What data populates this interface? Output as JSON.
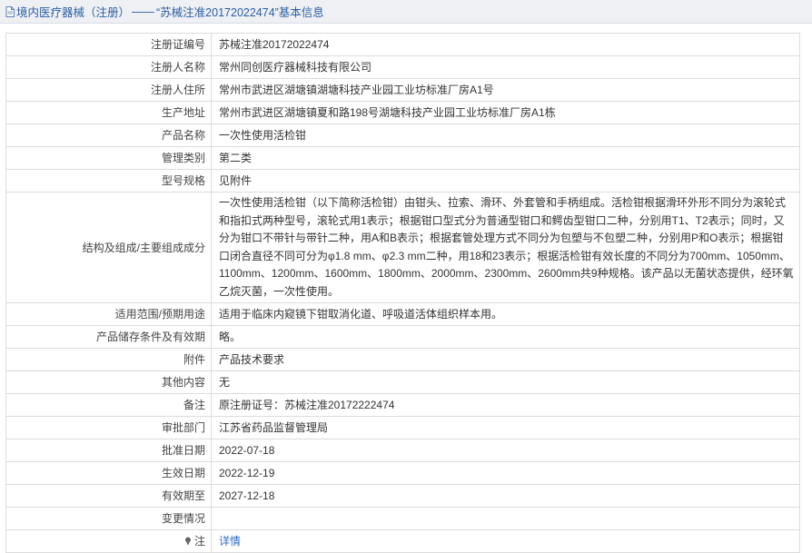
{
  "header": {
    "prefix": "境内医疗器械（注册）",
    "separator": "——",
    "title": "“苏械注准20172022474”基本信息",
    "icon": "document-icon"
  },
  "rows": [
    {
      "label": "注册证编号",
      "value": "苏械注准20172022474"
    },
    {
      "label": "注册人名称",
      "value": "常州同创医疗器械科技有限公司"
    },
    {
      "label": "注册人住所",
      "value": "常州市武进区湖塘镇湖塘科技产业园工业坊标准厂房A1号"
    },
    {
      "label": "生产地址",
      "value": "常州市武进区湖塘镇夏和路198号湖塘科技产业园工业坊标准厂房A1栋"
    },
    {
      "label": "产品名称",
      "value": "一次性使用活检钳"
    },
    {
      "label": "管理类别",
      "value": "第二类"
    },
    {
      "label": "型号规格",
      "value": "见附件"
    },
    {
      "label": "结构及组成/主要组成成分",
      "value": "一次性使用活检钳（以下简称活检钳）由钳头、拉索、滑环、外套管和手柄组成。活检钳根据滑环外形不同分为滚轮式和指扣式两种型号，滚轮式用1表示；根据钳口型式分为普通型钳口和鳄齿型钳口二种，分别用T1、T2表示；同时，又分为钳口不带针与带针二种，用A和B表示；根据套管处理方式不同分为包塑与不包塑二种，分别用P和O表示；根据钳口闭合直径不同可分为φ1.8 mm、φ2.3 mm二种，用18和23表示；根据活检钳有效长度的不同分为700mm、1050mm、1100mm、1200mm、1600mm、1800mm、2000mm、2300mm、2600mm共9种规格。该产品以无菌状态提供，经环氧乙烷灭菌，一次性使用。"
    },
    {
      "label": "适用范围/预期用途",
      "value": "适用于临床内窥镜下钳取消化道、呼吸道活体组织样本用。"
    },
    {
      "label": "产品储存条件及有效期",
      "value": "略。"
    },
    {
      "label": "附件",
      "value": "产品技术要求"
    },
    {
      "label": "其他内容",
      "value": "无"
    },
    {
      "label": "备注",
      "value": "原注册证号：苏械注准20172222474"
    },
    {
      "label": "审批部门",
      "value": "江苏省药品监督管理局"
    },
    {
      "label": "批准日期",
      "value": "2022-07-18"
    },
    {
      "label": "生效日期",
      "value": "2022-12-19"
    },
    {
      "label": "有效期至",
      "value": "2027-12-18"
    },
    {
      "label": "变更情况",
      "value": ""
    }
  ],
  "note_row": {
    "pin_icon": "pin-icon",
    "label": "注",
    "link": "详情"
  }
}
